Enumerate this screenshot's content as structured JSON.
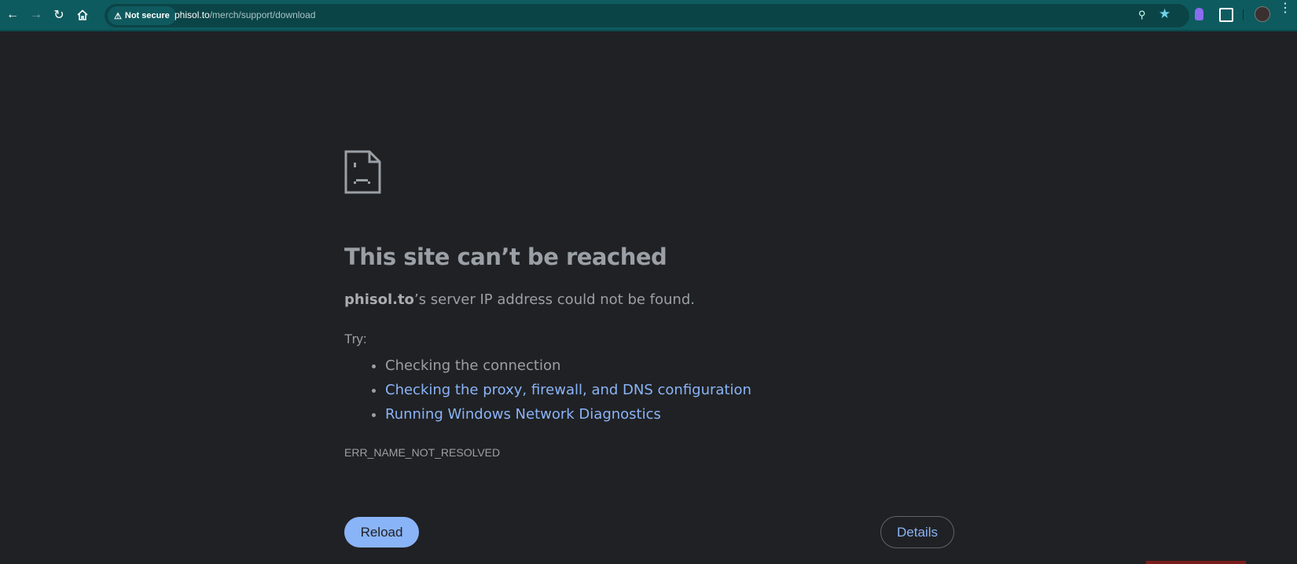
{
  "browser": {
    "security_chip": "Not secure",
    "url_host": "phisol.to",
    "url_path": "/merch/support/download"
  },
  "error": {
    "title": "This site can’t be reached",
    "host": "phisol.to",
    "message": "’s server IP address could not be found.",
    "try_label": "Try:",
    "suggestions": [
      "Checking the connection",
      "Checking the proxy, firewall, and DNS configuration",
      "Running Windows Network Diagnostics"
    ],
    "code": "ERR_NAME_NOT_RESOLVED",
    "reload_label": "Reload",
    "details_label": "Details"
  }
}
